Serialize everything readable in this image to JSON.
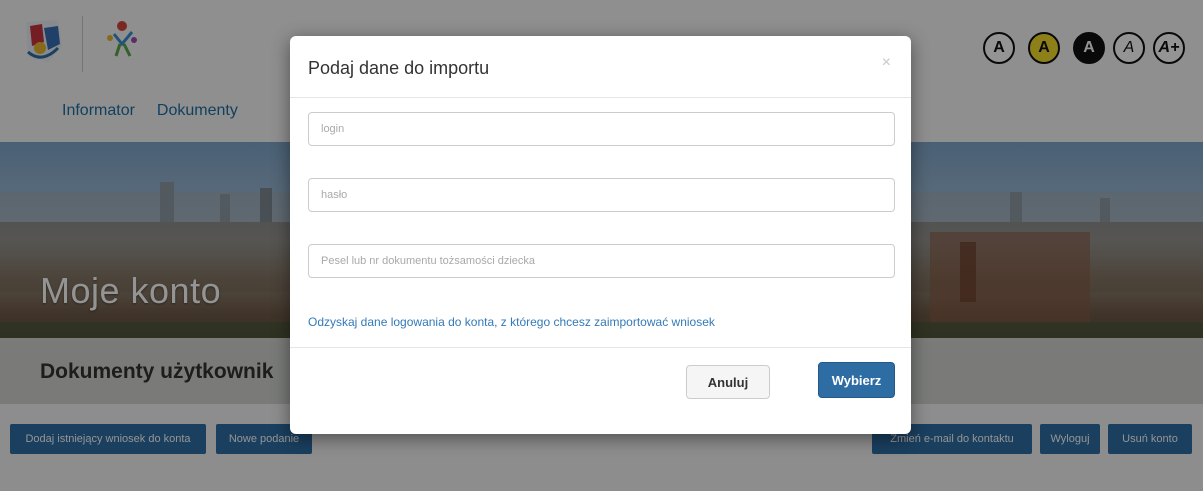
{
  "nav": {
    "items": [
      "Informator",
      "Dokumenty"
    ]
  },
  "accessibility": {
    "buttons": [
      {
        "label": "A",
        "name": "contrast-default"
      },
      {
        "label": "A",
        "name": "contrast-yellow"
      },
      {
        "label": "A",
        "name": "contrast-dark"
      },
      {
        "label": "A",
        "name": "font-normal"
      },
      {
        "label": "A+",
        "name": "font-larger"
      }
    ]
  },
  "page": {
    "title": "Moje konto",
    "subtitle": "Dokumenty użytkownik",
    "buttons": {
      "add_existing": "Dodaj istniejący wniosek do konta",
      "new_submission": "Nowe podanie",
      "change_email": "Zmień e-mail do kontaktu",
      "logout": "Wyloguj",
      "delete_account": "Usuń konto"
    }
  },
  "modal": {
    "title": "Podaj dane do importu",
    "close_symbol": "×",
    "login_placeholder": "login",
    "password_placeholder": "hasło",
    "pesel_placeholder": "Pesel lub nr dokumentu tożsamości dziecka",
    "recover_link": "Odzyskaj dane logowania do konta, z którego chcesz zaimportować wniosek",
    "cancel_label": "Anuluj",
    "submit_label": "Wybierz"
  },
  "colors": {
    "primary": "#2e6da4",
    "link": "#337ab7",
    "nav_text": "#1e6fa4",
    "a11y_yellow": "#f3dd2a"
  }
}
